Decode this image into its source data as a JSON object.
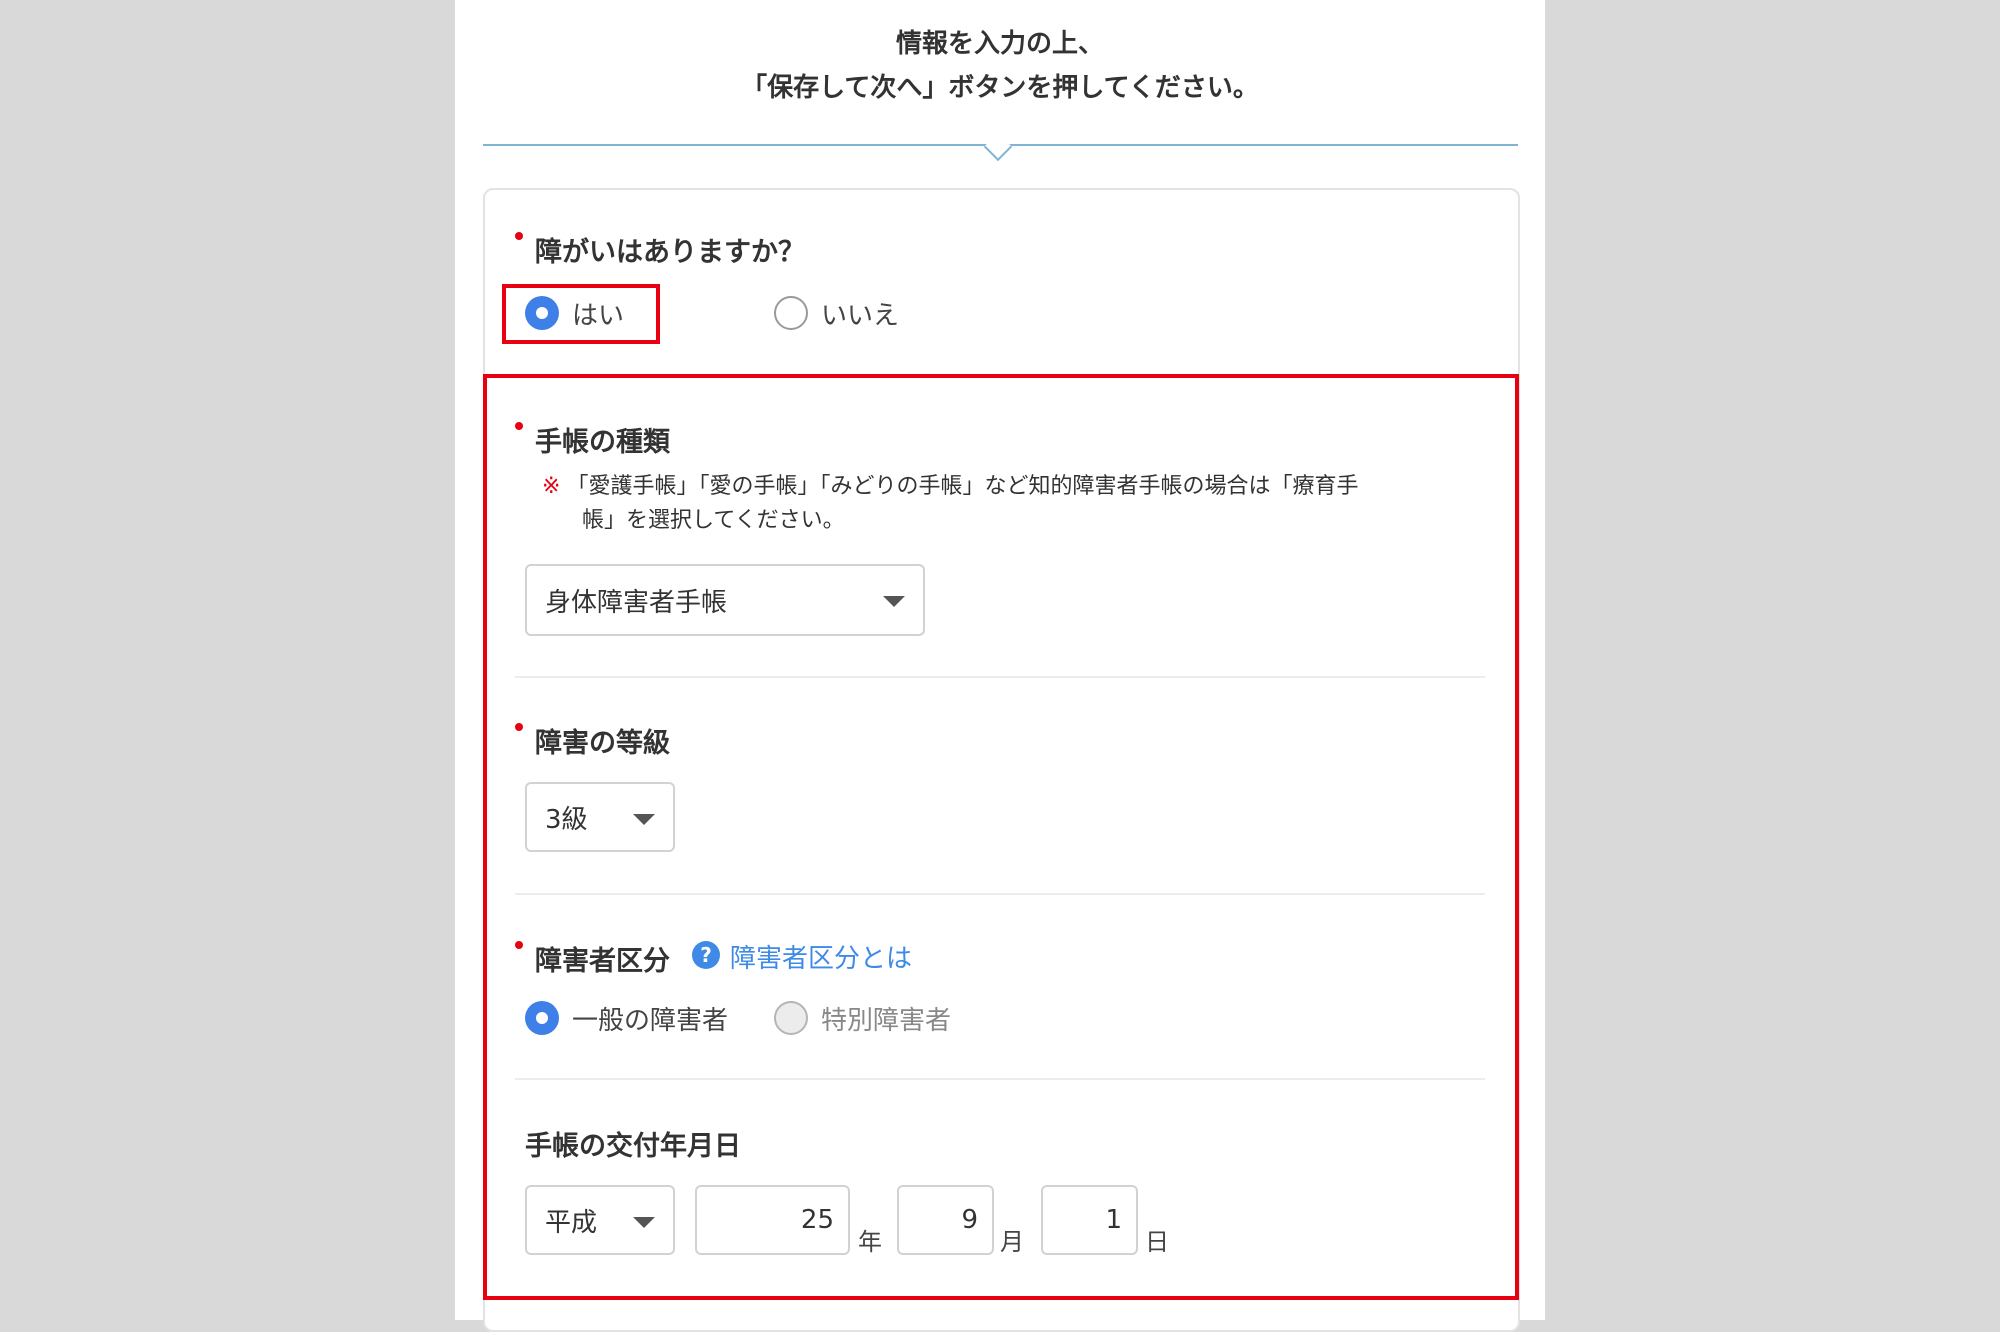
{
  "intro": {
    "line1": "情報を入力の上、",
    "line2": "「保存して次へ」ボタンを押してください。"
  },
  "disability": {
    "label": "障がいはありますか？",
    "options": [
      "はい",
      "いいえ"
    ],
    "selected": "はい"
  },
  "notebook_type": {
    "label": "手帳の種類",
    "note_mark": "※",
    "note_line1": "「愛護手帳」「愛の手帳」「みどりの手帳」など知的障害者手帳の場合は「療育手",
    "note_line2": "帳」を選択してください。",
    "value": "身体障害者手帳"
  },
  "grade": {
    "label": "障害の等級",
    "value": "3級"
  },
  "category": {
    "label": "障害者区分",
    "help_icon": "?",
    "help_link": "障害者区分とは",
    "options": [
      "一般の障害者",
      "特別障害者"
    ],
    "selected": "一般の障害者"
  },
  "issue_date": {
    "label": "手帳の交付年月日",
    "era": "平成",
    "year": "25",
    "year_unit": "年",
    "month": "9",
    "month_unit": "月",
    "day": "1",
    "day_unit": "日"
  },
  "colors": {
    "accent_blue": "#3f7fe8",
    "highlight_red": "#e60012",
    "divider": "#7fb4d4"
  }
}
